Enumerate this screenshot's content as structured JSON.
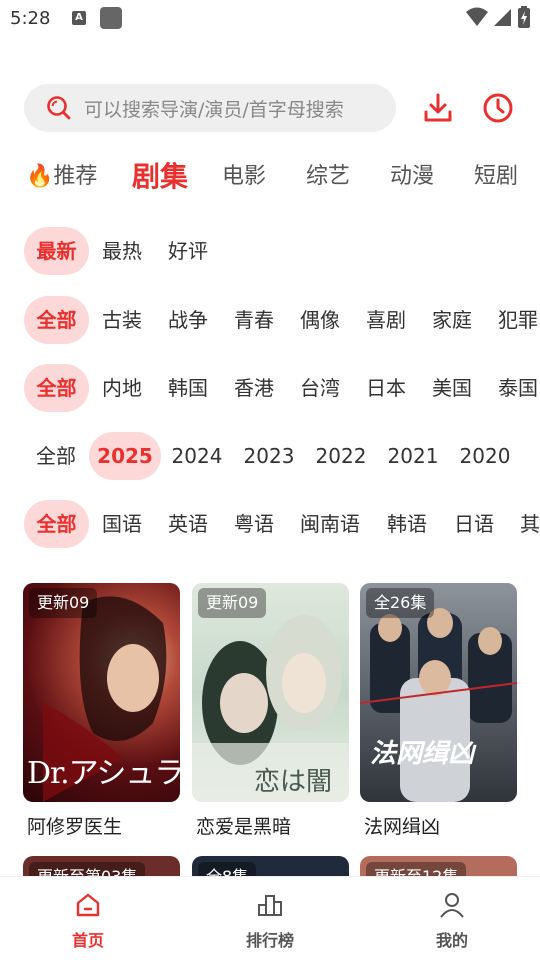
{
  "status": {
    "time": "5:28",
    "a_icon": "A"
  },
  "search": {
    "placeholder": "可以搜索导演/演员/首字母搜索"
  },
  "categories": [
    "推荐",
    "剧集",
    "电影",
    "综艺",
    "动漫",
    "短剧"
  ],
  "active_category": "剧集",
  "filters": {
    "sort": [
      "最新",
      "最热",
      "好评"
    ],
    "genre": [
      "全部",
      "古装",
      "战争",
      "青春",
      "偶像",
      "喜剧",
      "家庭",
      "犯罪"
    ],
    "region": [
      "全部",
      "内地",
      "韩国",
      "香港",
      "台湾",
      "日本",
      "美国",
      "泰国"
    ],
    "year": [
      "全部",
      "2025",
      "2024",
      "2023",
      "2022",
      "2021",
      "2020"
    ],
    "language": [
      "全部",
      "国语",
      "英语",
      "粤语",
      "闽南语",
      "韩语",
      "日语",
      "其他"
    ]
  },
  "posters": [
    {
      "badge": "更新09",
      "title": "阿修罗医生",
      "art_text": "Dr.アシュラ"
    },
    {
      "badge": "更新09",
      "title": "恋爱是黑暗",
      "art_text": "恋は闇"
    },
    {
      "badge": "全26集",
      "title": "法网缉凶",
      "art_text": "法网缉凶"
    }
  ],
  "posters_row2": [
    {
      "badge": "更新至第03集"
    },
    {
      "badge": "全8集"
    },
    {
      "badge": "更新至12集"
    }
  ],
  "nav": {
    "home": "首页",
    "ranking": "排行榜",
    "mine": "我的"
  },
  "colors": {
    "accent": "#e8312f",
    "chip_bg": "#fdd8d8"
  }
}
